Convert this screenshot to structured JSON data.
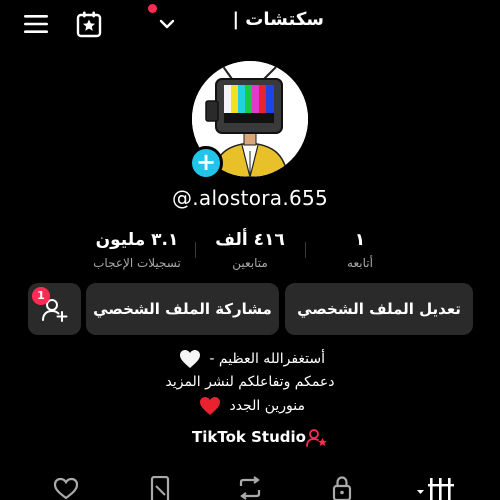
{
  "header": {
    "title": "سكتشات |",
    "icons": [
      "hamburger-menu-icon",
      "calendar-star-icon",
      "chevron-down-icon"
    ],
    "notification_dot_color": "#fe2c55"
  },
  "profile": {
    "username": "@.alostora.655",
    "avatar_add_symbol": "+",
    "avatar_add_color": "#20c5e8"
  },
  "stats": [
    {
      "value": "١",
      "label": "أتابعه"
    },
    {
      "value": "٤١٦ ألف",
      "label": "متابعين"
    },
    {
      "value": "٣.١ مليون",
      "label": "تسجيلات الإعجاب"
    }
  ],
  "actions": {
    "edit_profile": "تعديل الملف الشخصي",
    "share_profile": "مشاركة الملف الشخصي",
    "friend_requests_badge": "1"
  },
  "bio": {
    "line1": "أستغفرالله العظيم -",
    "line2": "دعمكم وتفاعلكم لنشر المزيد",
    "line3": "منورين الجدد"
  },
  "studio": {
    "label": "TikTok Studio"
  },
  "tabs": [
    "grid-videos-icon",
    "lock-icon",
    "repost-icon",
    "bookmark-icon",
    "liked-icon"
  ]
}
